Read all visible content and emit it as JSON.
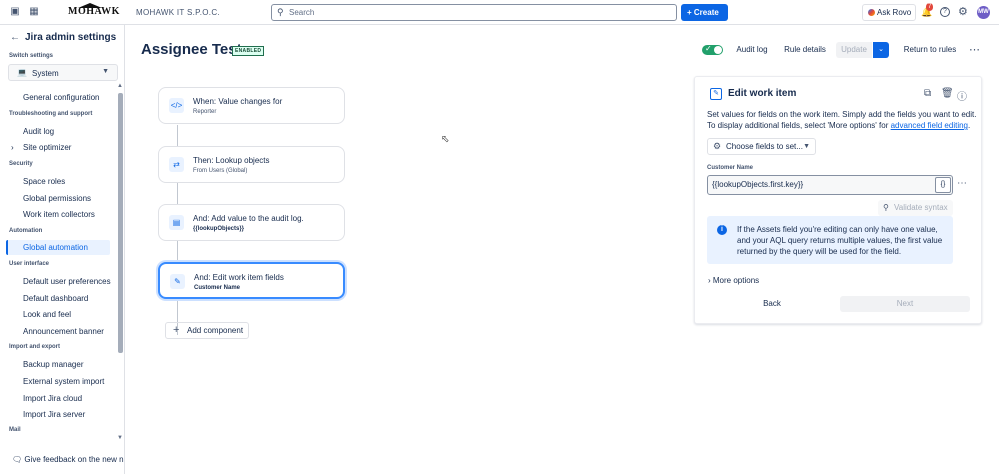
{
  "topbar": {
    "logo": "MOHAWK",
    "company": "MOHAWK IT S.P.O.C.",
    "search_placeholder": "Search",
    "create_label": "Create",
    "ask_rovo_label": "Ask Rovo",
    "notification_count": "7",
    "avatar_initials": "MW"
  },
  "sidebar": {
    "title": "Jira admin settings",
    "switch_label": "Switch settings",
    "switch_value": "System",
    "items": [
      {
        "type": "item",
        "label": "General configuration"
      },
      {
        "type": "section",
        "label": "Troubleshooting and support"
      },
      {
        "type": "item",
        "label": "Audit log"
      },
      {
        "type": "item",
        "label": "Site optimizer"
      },
      {
        "type": "section",
        "label": "Security"
      },
      {
        "type": "item",
        "label": "Space roles"
      },
      {
        "type": "item",
        "label": "Global permissions"
      },
      {
        "type": "item",
        "label": "Work item collectors"
      },
      {
        "type": "section",
        "label": "Automation"
      },
      {
        "type": "item",
        "label": "Global automation",
        "active": true
      },
      {
        "type": "section",
        "label": "User interface"
      },
      {
        "type": "item",
        "label": "Default user preferences"
      },
      {
        "type": "item",
        "label": "Default dashboard"
      },
      {
        "type": "item",
        "label": "Look and feel"
      },
      {
        "type": "item",
        "label": "Announcement banner"
      },
      {
        "type": "section",
        "label": "Import and export"
      },
      {
        "type": "item",
        "label": "Backup manager"
      },
      {
        "type": "item",
        "label": "External system import"
      },
      {
        "type": "item",
        "label": "Import Jira cloud"
      },
      {
        "type": "item",
        "label": "Import Jira server"
      },
      {
        "type": "section",
        "label": "Mail"
      }
    ],
    "feedback_label": "Give feedback on the new navigation"
  },
  "rule": {
    "title": "Assignee Test",
    "status_badge": "ENABLED",
    "audit_log_label": "Audit log",
    "rule_details_label": "Rule details",
    "update_label": "Update",
    "return_label": "Return to rules"
  },
  "flow": {
    "cards": [
      {
        "line1": "When: Value changes for",
        "line2": "Reporter",
        "icon": "code-icon"
      },
      {
        "line1": "Then: Lookup objects",
        "line2": "From Users (Global)",
        "icon": "branch-icon"
      },
      {
        "line1": "And: Add value to the audit log.",
        "line2": "{{lookupObjects}}",
        "icon": "log-icon"
      },
      {
        "line1": "And: Edit work item fields",
        "line2": "Customer Name",
        "icon": "edit-icon"
      }
    ],
    "add_component_label": "Add component"
  },
  "panel": {
    "title": "Edit work item",
    "description": "Set values for fields on the work item. Simply add the fields you want to edit. To display additional fields, select 'More options' for",
    "link_text": "advanced field editing",
    "choose_fields_label": "Choose fields to set...",
    "field_label": "Customer Name",
    "field_value": "{{lookupObjects.first.key}}",
    "field_brace": "{}",
    "validate_label": "Validate syntax",
    "info_text": "If the Assets field you're editing can only have one value, and your AQL query returns multiple values, the first value returned by the query will be used for the field.",
    "more_options_label": "More options",
    "back_label": "Back",
    "next_label": "Next"
  },
  "colors": {
    "primary": "#0c66e4",
    "enabled_bg": "#dcfff1",
    "toggle_on": "#22a06b",
    "info_bg": "#e9f2ff"
  }
}
